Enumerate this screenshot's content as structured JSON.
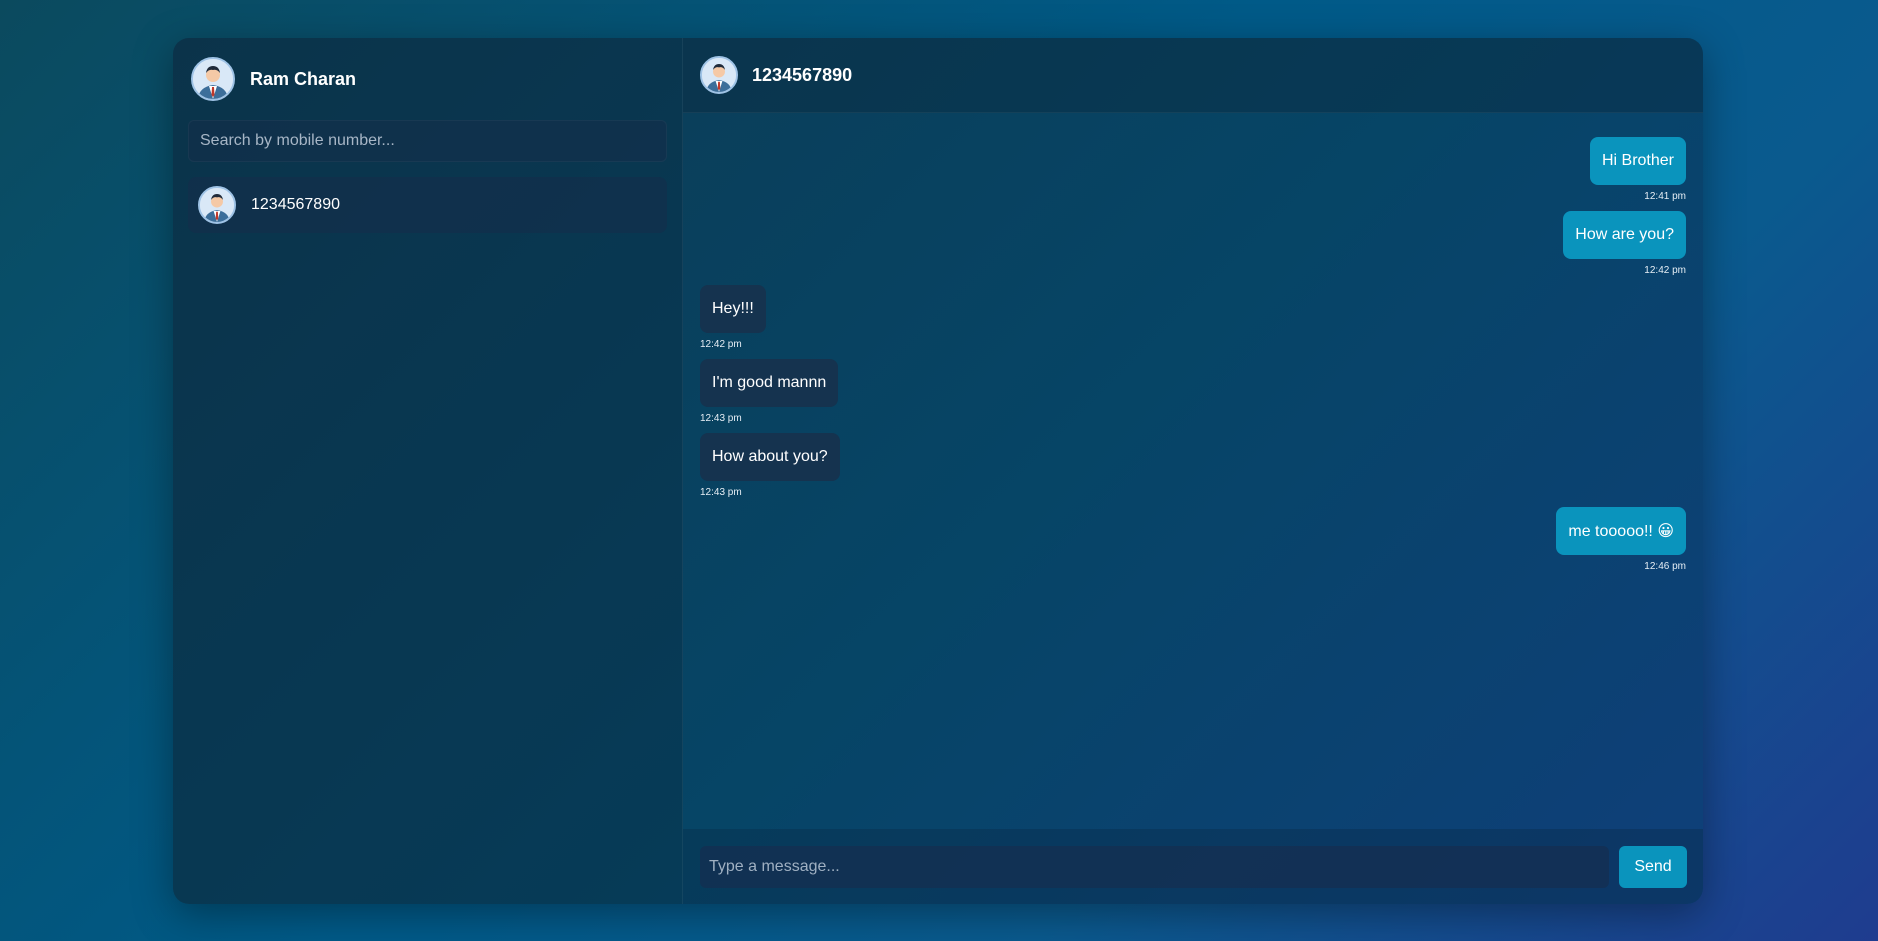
{
  "colors": {
    "accent": "#0a94bd",
    "received_bubble": "#15334f"
  },
  "sidebar": {
    "profile": {
      "name": "Ram Charan",
      "avatar_icon": "user-avatar-icon"
    },
    "search": {
      "placeholder": "Search by mobile number...",
      "value": ""
    },
    "contacts": [
      {
        "name": "1234567890",
        "avatar_icon": "user-avatar-icon"
      }
    ]
  },
  "chat": {
    "header": {
      "name": "1234567890",
      "avatar_icon": "user-avatar-icon"
    },
    "messages": [
      {
        "direction": "sent",
        "text": "Hi Brother",
        "time": "12:41 pm"
      },
      {
        "direction": "sent",
        "text": "How are you?",
        "time": "12:42 pm"
      },
      {
        "direction": "received",
        "text": "Hey!!!",
        "time": "12:42 pm"
      },
      {
        "direction": "received",
        "text": "I'm good mannn",
        "time": "12:43 pm"
      },
      {
        "direction": "received",
        "text": "How about you?",
        "time": "12:43 pm"
      },
      {
        "direction": "sent",
        "text": "me tooooo!! 😀",
        "time": "12:46 pm"
      }
    ],
    "composer": {
      "placeholder": "Type a message...",
      "value": "",
      "send_label": "Send"
    }
  }
}
